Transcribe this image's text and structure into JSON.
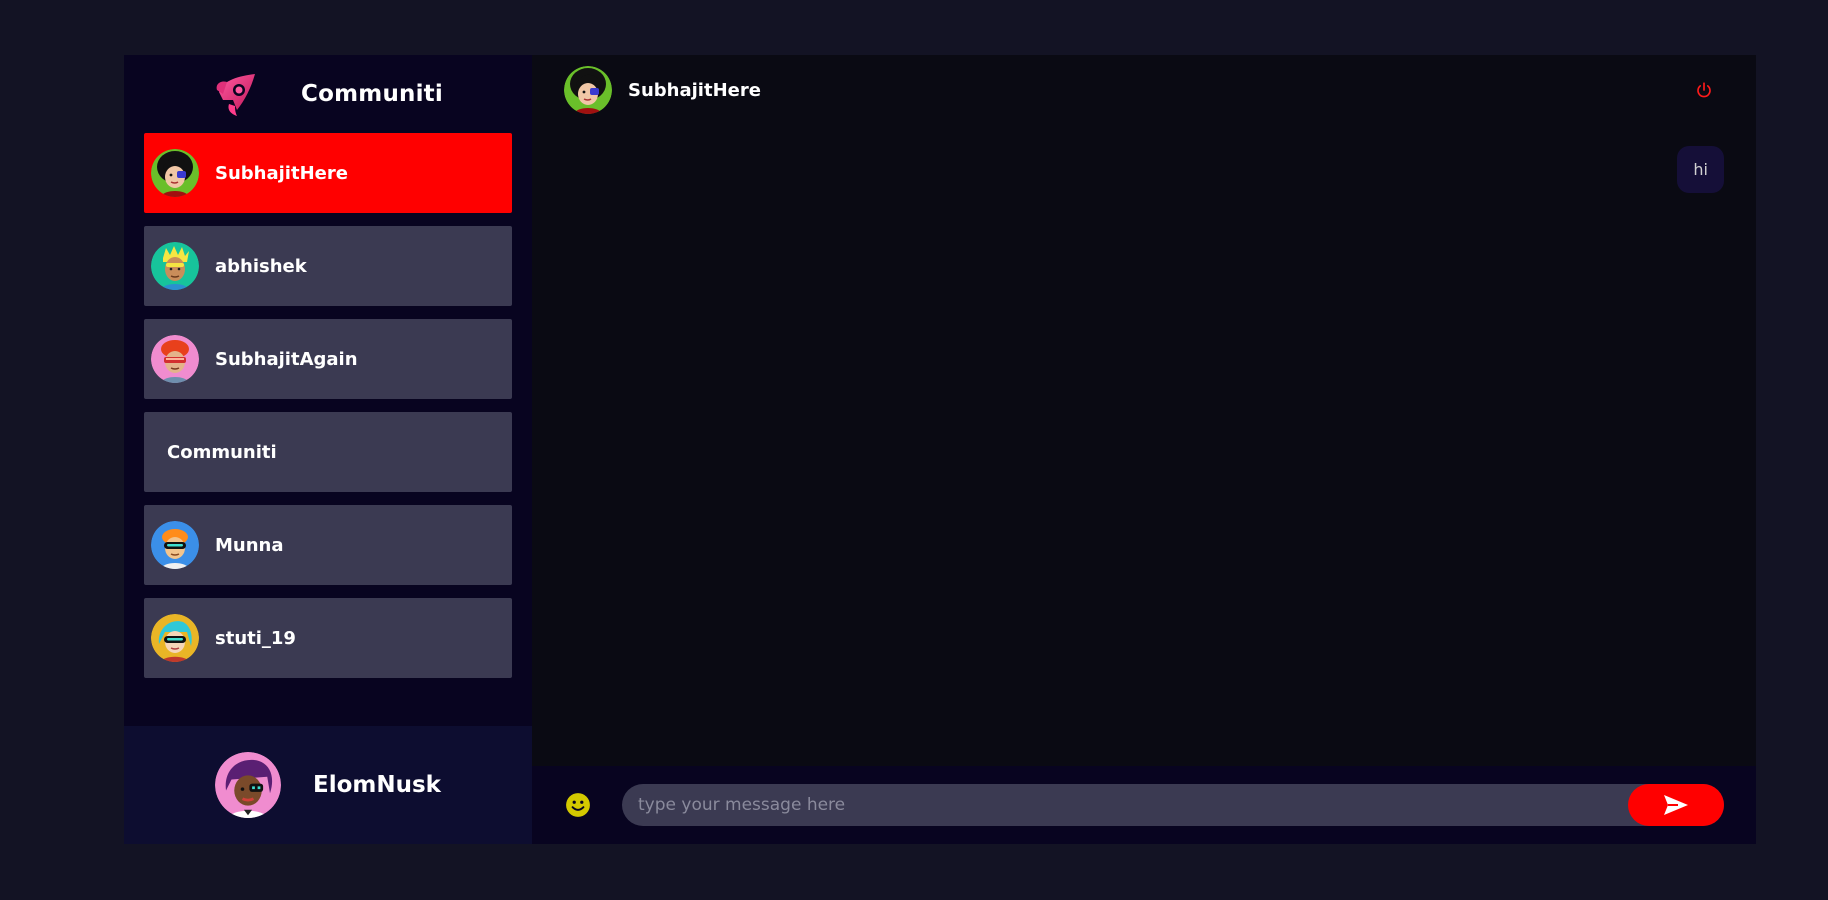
{
  "brand": {
    "name": "Communiti",
    "logo_icon": "rocket-logo-icon",
    "logo_colors": [
      "#ff3d8b",
      "#c2185b"
    ]
  },
  "contacts": [
    {
      "name": "SubhajitHere",
      "avatar": "avatar-black-hair",
      "selected": true
    },
    {
      "name": "abhishek",
      "avatar": "avatar-blonde-green-bg",
      "selected": false
    },
    {
      "name": "SubhajitAgain",
      "avatar": "avatar-red-hair-pink-bg",
      "selected": false
    },
    {
      "name": "Communiti",
      "avatar": null,
      "selected": false
    },
    {
      "name": "Munna",
      "avatar": "avatar-visor-blue-bg",
      "selected": false
    },
    {
      "name": "stuti_19",
      "avatar": "avatar-visor-yellow-bg",
      "selected": false
    }
  ],
  "current_user": {
    "name": "ElomNusk",
    "avatar": "avatar-purple-hair-pink-bg"
  },
  "chat": {
    "header_name": "SubhajitHere",
    "header_avatar": "avatar-black-hair",
    "logout_icon": "power-icon",
    "messages": [
      {
        "text": "hi",
        "sent": true
      }
    ],
    "input": {
      "placeholder": "type your message here",
      "value": ""
    },
    "emoji_icon": "smile-icon",
    "send_icon": "send-arrow-icon"
  },
  "colors": {
    "page_bg": "#131324",
    "sidebar_bg": "#080420",
    "contact_bg": "#3b3a52",
    "selected_bg": "#ff0000",
    "chat_bg": "#0a0a13",
    "bubble_bg": "#150f38",
    "emoji": "#d4c900"
  }
}
